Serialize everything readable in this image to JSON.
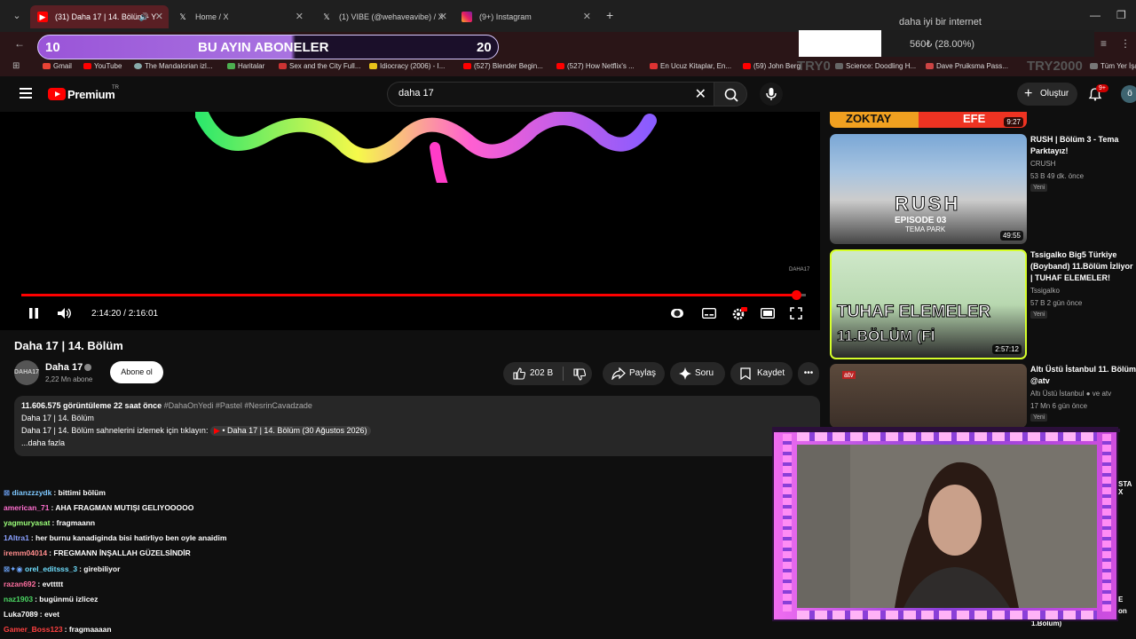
{
  "browser": {
    "tabs": [
      {
        "title": "(31) Daha 17 | 14. Bölüm - Y",
        "icon": "youtube-icon",
        "active": true
      },
      {
        "title": "Home / X",
        "icon": "x-icon"
      },
      {
        "title": "(1) VIBE (@wehaveavibe) / X",
        "icon": "x-icon"
      },
      {
        "title": "(9+) Instagram",
        "icon": "instagram-icon"
      }
    ],
    "bookmarks": [
      {
        "label": "Gmail",
        "color": "#ea4335"
      },
      {
        "label": "YouTube",
        "color": "#ff0000"
      },
      {
        "label": "The Mandalorian izl...",
        "color": "#8aa"
      },
      {
        "label": "Haritalar",
        "color": "#4caf50"
      },
      {
        "label": "Sex and the City Full...",
        "color": "#c33"
      },
      {
        "label": "Idiocracy (2006) - I...",
        "color": "#e8c21a"
      },
      {
        "label": "(527) Blender Begin...",
        "color": "#ff0000"
      },
      {
        "label": "(527) How Netflix's ...",
        "color": "#ff0000"
      },
      {
        "label": "En Ucuz Kitaplar, En...",
        "color": "#d33"
      },
      {
        "label": "(59) John Berg",
        "color": "#ff0000"
      },
      {
        "label": "Science: Doodling H...",
        "color": "#666"
      },
      {
        "label": "Dave Pruiksma Pass...",
        "color": "#c44"
      },
      {
        "label": "Tüm Yer İşa",
        "color": "#777"
      }
    ]
  },
  "overlay": {
    "goal_start": "10",
    "goal_title": "BU AYIN ABONELER",
    "goal_end": "20",
    "goal_progress": 0.55,
    "net_title": "daha iyi bir internet",
    "net_value": "560₺ (28.00%)",
    "try_left": "TRY0",
    "try_right": "TRY2000"
  },
  "header": {
    "brand": "Premium",
    "region": "TR",
    "search_value": "daha 17",
    "create_label": "Oluştur",
    "notif_count": "9+",
    "avatar_letter": "ö"
  },
  "player": {
    "time_current": "2:14:20",
    "time_total": "2:16:01",
    "time_label": "2:14:20 / 2:16:01",
    "progress": 0.988,
    "channel_logo": "DAHA17"
  },
  "video": {
    "title": "Daha 17 | 14. Bölüm",
    "channel": "Daha 17",
    "channel_logo": "DAHA17",
    "subscribers": "2,22 Mn abone",
    "subscribe_label": "Abone ol",
    "likes": "202 B",
    "share_label": "Paylaş",
    "ask_label": "Soru",
    "save_label": "Kaydet",
    "views": "11.606.575 görüntüleme  22 saat önce",
    "hashtags": "#DahaOnYedi #Pastel #NesrinCavadzade",
    "desc_line1": "Daha 17 | 14. Bölüm",
    "desc_line2": "Daha 17 | 14. Bölüm sahnelerini izlemek için tıklayın:",
    "desc_link": "• Daha 17 | 14. Bölüm (30 Ağustos 2026)",
    "more_label": "...daha fazla"
  },
  "chat": [
    {
      "name": "dianzzzydk",
      "text": ": bittimi bölüm",
      "color": "#7ec8ff"
    },
    {
      "name": "american_71",
      "text": ": AHA FRAGMAN MUTIŞI GELIYOOOOO",
      "color": "#ff6fd0"
    },
    {
      "name": "yagmuryasat",
      "text": ": fragmaann",
      "color": "#9cff7a"
    },
    {
      "name": "1Altra1",
      "text": ": her burnu kanadiginda bisi hatirliyo ben oyle anaidim",
      "color": "#8aa0ff"
    },
    {
      "name": "iremm04014",
      "text": ": FREGMANN İNŞALLAH GÜZELSİNDİR",
      "color": "#ff8c8c"
    },
    {
      "name": "orel_editsss_3",
      "text": ": girebiliyor",
      "color": "#6fdfff"
    },
    {
      "name": "razan692",
      "text": ": evttttt",
      "color": "#ff6fa0"
    },
    {
      "name": "naz1903",
      "text": ": bugünmü izlicez",
      "color": "#4cd964"
    },
    {
      "name": "Luka7089",
      "text": ": evet",
      "color": "#ffffff"
    },
    {
      "name": "Gamer_Boss123",
      "text": ": fragmaaaan",
      "color": "#ff4040"
    }
  ],
  "recommendations": [
    {
      "title": "RUSH | Bölüm 3 - Tema Parktayız!",
      "channel": "CRUSH",
      "meta": "53 B  49 dk. önce",
      "badge": "Yeni",
      "duration": "49:55",
      "thumb_text": "RUSH",
      "thumb_sub": "EPISODE 03",
      "thumb_sub2": "TEMA PARK"
    },
    {
      "title": "Tssigalko Big5 Türkiye (Boyband) 11.Bölüm İzliyor | TUHAF ELEMELER!",
      "channel": "Tssigalko",
      "meta": "57 B  2 gün önce",
      "badge": "Yeni",
      "duration": "2:57:12",
      "thumb_text": "TUHAF ELEMELER",
      "thumb_sub": "11.BÖLÜM (Fİ"
    },
    {
      "title": "Altı Üstü İstanbul 11. Bölüm @atv",
      "channel": "Altı Üstü İstanbul",
      "channel2": "ve atv",
      "meta": "17 Mn  6 gün önce",
      "badge": "Yeni"
    }
  ],
  "top_thumb": {
    "left_label": "ZOKTAY",
    "right_label": "EFE",
    "duration": "9:27"
  },
  "peek": {
    "a": "STA X",
    "b": "E",
    "c": "on",
    "d": "1.Bölüm)"
  }
}
